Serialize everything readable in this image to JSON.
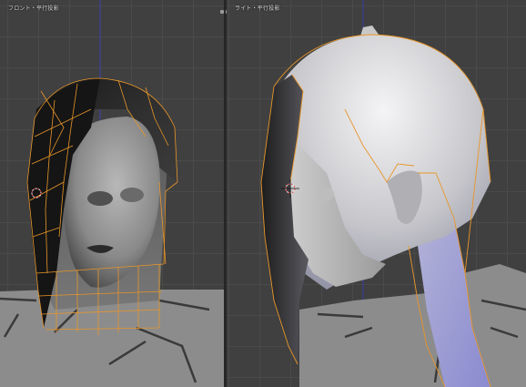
{
  "viewports": {
    "front": {
      "label": "フロント・平行投影"
    },
    "right": {
      "label": "ライト・平行投影"
    }
  },
  "colors": {
    "background": "#404040",
    "grid": "#4a4a4a",
    "selection": "#e8962a",
    "axis_line": "#3a3aaa"
  },
  "icons": {
    "split": "area-split-icon",
    "cursor": "3d-cursor-icon"
  }
}
